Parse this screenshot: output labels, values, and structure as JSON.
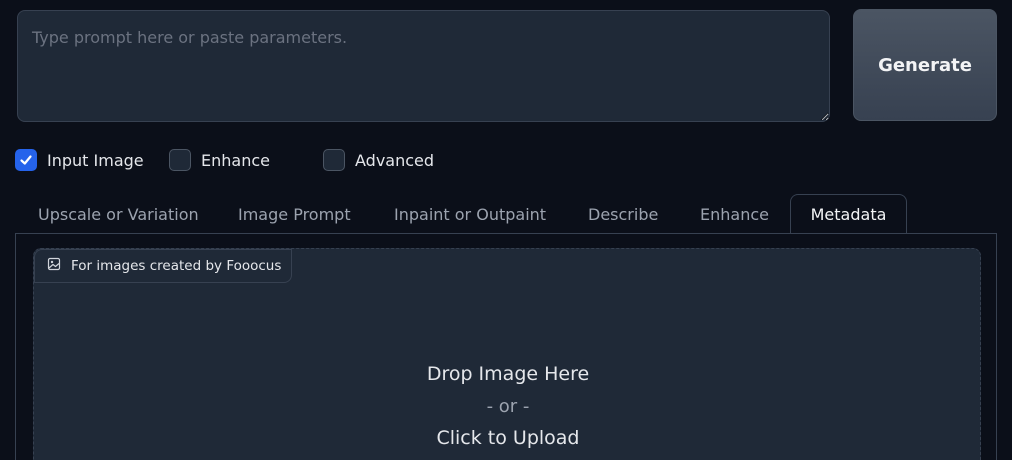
{
  "prompt": {
    "placeholder": "Type prompt here or paste parameters.",
    "value": ""
  },
  "generate_button": {
    "label": "Generate"
  },
  "options": [
    {
      "label": "Input Image",
      "checked": true
    },
    {
      "label": "Enhance",
      "checked": false
    },
    {
      "label": "Advanced",
      "checked": false
    }
  ],
  "tabs": [
    {
      "label": "Upscale or Variation",
      "active": false
    },
    {
      "label": "Image Prompt",
      "active": false
    },
    {
      "label": "Inpaint or Outpaint",
      "active": false
    },
    {
      "label": "Describe",
      "active": false
    },
    {
      "label": "Enhance",
      "active": false
    },
    {
      "label": "Metadata",
      "active": true
    }
  ],
  "metadata_panel": {
    "image_label": "For images created by Fooocus",
    "image_icon": "image-icon",
    "drop_text": "Drop Image Here",
    "or_text": "- or -",
    "upload_text": "Click to Upload"
  },
  "colors": {
    "background": "#0b0f19",
    "surface": "#1f2937",
    "border": "#374151",
    "accent": "#2563eb"
  }
}
